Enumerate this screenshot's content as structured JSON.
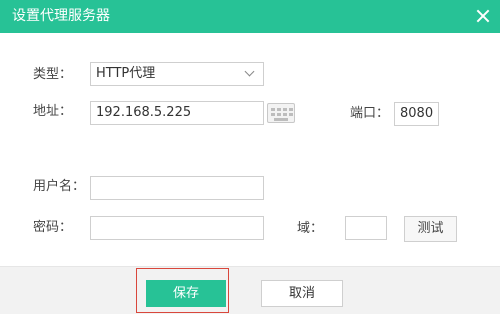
{
  "dialog": {
    "title": "设置代理服务器",
    "close_icon": "close-icon"
  },
  "form": {
    "type_label": "类型：",
    "type_value": "HTTP代理",
    "address_label": "地址：",
    "address_value": "192.168.5.225",
    "keyboard_icon": "keyboard-icon",
    "port_label": "端口：",
    "port_value": "8080",
    "username_label": "用户名：",
    "username_value": "",
    "password_label": "密码：",
    "password_value": "",
    "domain_label": "域：",
    "domain_value": "",
    "test_label": "测试"
  },
  "footer": {
    "save_label": "保存",
    "cancel_label": "取消"
  },
  "colors": {
    "accent": "#27c296",
    "highlight_border": "#d9473c"
  }
}
